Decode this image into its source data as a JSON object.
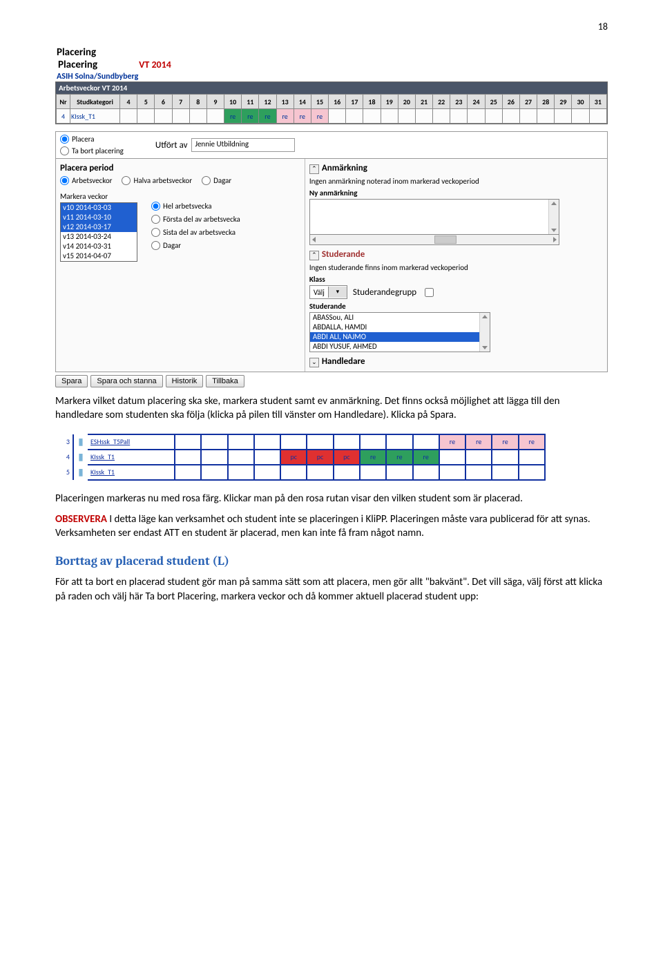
{
  "page_number": "18",
  "ui": {
    "heading1": "Placering",
    "heading2": "Placering",
    "term": "VT 2014",
    "org": "ASIH Solna/Sundbyberg",
    "weeks_bar": "Arbetsveckor VT 2014",
    "week_headers": [
      "Nr",
      "Studkategori",
      "4",
      "5",
      "6",
      "7",
      "8",
      "9",
      "10",
      "11",
      "12",
      "13",
      "14",
      "15",
      "16",
      "17",
      "18",
      "19",
      "20",
      "21",
      "22",
      "23",
      "24",
      "25",
      "26",
      "27",
      "28",
      "29",
      "30",
      "31"
    ],
    "week_row": {
      "nr": "4",
      "cat": "KIssk_T1",
      "cells": [
        "",
        "",
        "",
        "",
        "",
        "",
        "re",
        "re",
        "re",
        "re",
        "re",
        "re",
        "",
        "",
        "",
        "",
        "",
        "",
        "",
        "",
        "",
        "",
        "",
        "",
        "",
        "",
        "",
        ""
      ]
    },
    "radio_placera": "Placera",
    "radio_tabort": "Ta bort placering",
    "utfort_label": "Utfört av",
    "utfort_value": "Jennie Utbildning",
    "left_panel_title": "Placera period",
    "period_choices": [
      "Arbetsveckor",
      "Halva arbetsveckor",
      "Dagar"
    ],
    "markera_label": "Markera veckor",
    "veckor": [
      "v10 2014-03-03",
      "v11 2014-03-10",
      "v12 2014-03-17",
      "v13 2014-03-24",
      "v14 2014-03-31",
      "v15 2014-04-07"
    ],
    "vecka_choices": [
      "Hel arbetsvecka",
      "Första del av arbetsvecka",
      "Sista del av arbetsvecka",
      "Dagar"
    ],
    "anmarkning_title": "Anmärkning",
    "anmarkning_text": "Ingen anmärkning noterad inom markerad veckoperiod",
    "ny_anmarkning": "Ny anmärkning",
    "studerande_title": "Studerande",
    "studerande_text": "Ingen studerande finns inom markerad veckoperiod",
    "klass_label": "Klass",
    "klass_value": "Välj",
    "studerandegrupp_label": "Studerandegrupp",
    "studerande_label": "Studerande",
    "studerande_list": [
      "ABASSou, ALI",
      "ABDALLA, HAMDI",
      "ABDI ALI, NAJMO",
      "ABDI YUSUF, AHMED"
    ],
    "handledare_title": "Handledare",
    "buttons": [
      "Spara",
      "Spara och stanna",
      "Historik",
      "Tillbaka"
    ]
  },
  "para1": "Markera vilket datum placering ska ske, markera student samt ev anmärkning. Det finns också möjlighet att lägga till den handledare som studenten ska följa (klicka på pilen till vänster om Handledare). Klicka på Spara.",
  "schema2": {
    "rows": [
      {
        "nr": "3",
        "cat": "ESHssk_T5Pall",
        "cells": [
          "",
          "",
          "",
          "",
          "",
          "",
          "",
          "",
          "",
          "",
          "re",
          "re",
          "re",
          "re"
        ]
      },
      {
        "nr": "4",
        "cat": "KIssk_T1",
        "cells": [
          "",
          "",
          "",
          "",
          "pc",
          "pc",
          "pc",
          "re",
          "re",
          "re",
          "",
          "",
          "",
          ""
        ]
      },
      {
        "nr": "5",
        "cat": "KIssk_T1",
        "cells": [
          "",
          "",
          "",
          "",
          "",
          "",
          "",
          "",
          "",
          "",
          "",
          "",
          "",
          ""
        ]
      }
    ]
  },
  "para2": "Placeringen markeras nu med rosa färg. Klickar man på den rosa rutan visar den vilken student som är placerad.",
  "para3_prefix": "OBSERVERA",
  "para3": " I detta läge kan verksamhet och student inte se placeringen i KliPP. Placeringen måste vara publicerad för att synas. Verksamheten ser endast ATT en student är placerad, men kan inte få fram något namn.",
  "section_title": "Borttag av placerad student (L)",
  "para4": "För att ta bort en placerad student gör man på samma sätt som att placera, men gör allt \"bakvänt\". Det vill säga, välj först att klicka på raden och välj här Ta bort Placering, markera veckor och då kommer aktuell placerad student upp:"
}
